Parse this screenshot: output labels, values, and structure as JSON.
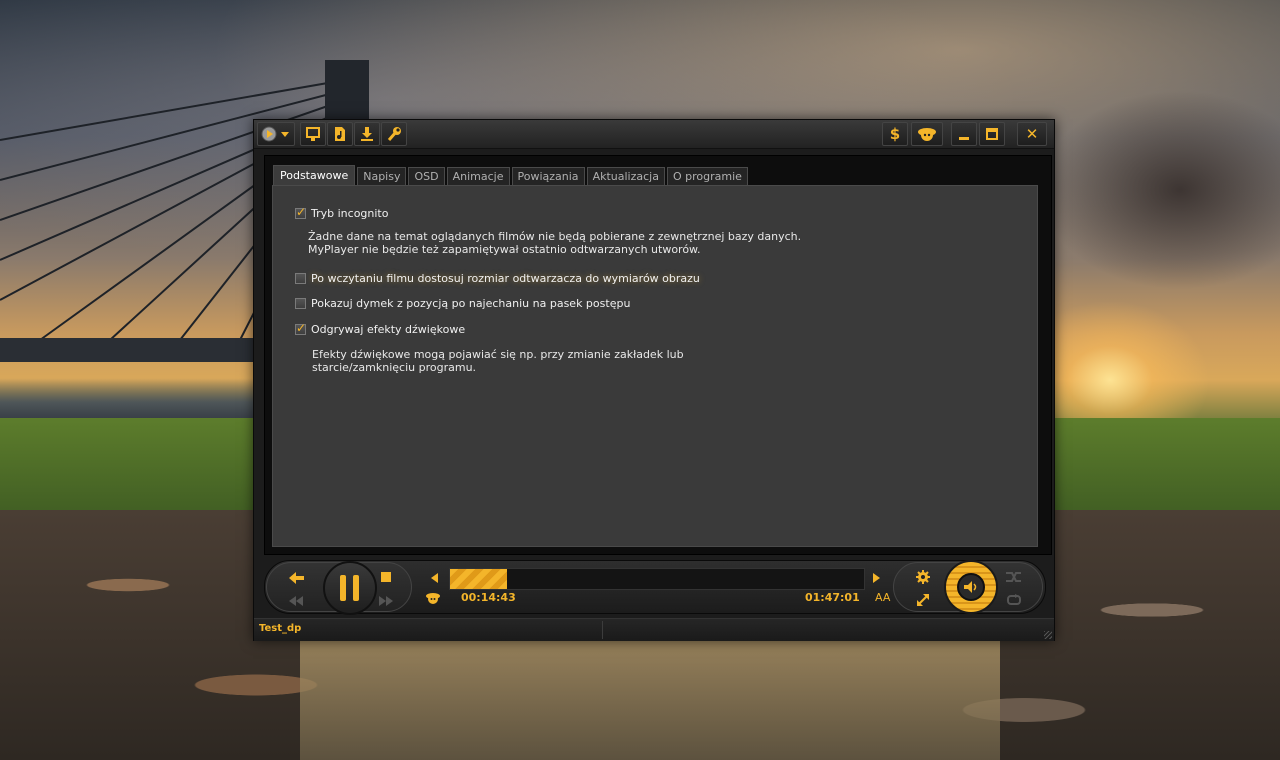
{
  "player": {
    "tabs": [
      "Podstawowe",
      "Napisy",
      "OSD",
      "Animacje",
      "Powiązania",
      "Aktualizacja",
      "O programie"
    ],
    "active_tab": "Podstawowe",
    "options": {
      "incognito": {
        "label": "Tryb incognito",
        "checked": true,
        "desc1": "Żadne dane na temat oglądanych filmów nie będą pobierane z zewnętrznej bazy danych.",
        "desc2": "MyPlayer nie będzie też zapamiętywał ostatnio odtwarzanych utworów."
      },
      "resize": {
        "label": "Po wczytaniu filmu dostosuj rozmiar odtwarzacza do wymiarów obrazu",
        "checked": false
      },
      "tooltip": {
        "label": "Pokazuj dymek z pozycją po najechaniu na pasek postępu",
        "checked": false
      },
      "sounds": {
        "label": "Odgrywaj efekty dźwiękowe",
        "checked": true,
        "desc1": "Efekty dźwiękowe mogą pojawiać się np. przy zmianie zakładek lub",
        "desc2": "starcie/zamknięciu programu."
      }
    },
    "playback": {
      "current_time": "00:14:43",
      "total_time": "01:47:01",
      "progress_fraction": 0.137,
      "subtitle_button": "AA"
    },
    "status": {
      "file_name": "Test_dp"
    },
    "accent_color": "#f4b52a",
    "icons": [
      "media-menu-icon",
      "monitor-icon",
      "file-icon",
      "download-icon",
      "wrench-icon",
      "dollar-icon",
      "mascot-icon",
      "minimize-icon",
      "maximize-icon",
      "close-icon",
      "back-icon",
      "pause-icon",
      "stop-icon",
      "rewind-icon",
      "fast-forward-icon",
      "seek-left-icon",
      "seek-right-icon",
      "gear-icon",
      "fullscreen-icon",
      "speaker-icon",
      "shuffle-icon",
      "repeat-icon"
    ]
  }
}
